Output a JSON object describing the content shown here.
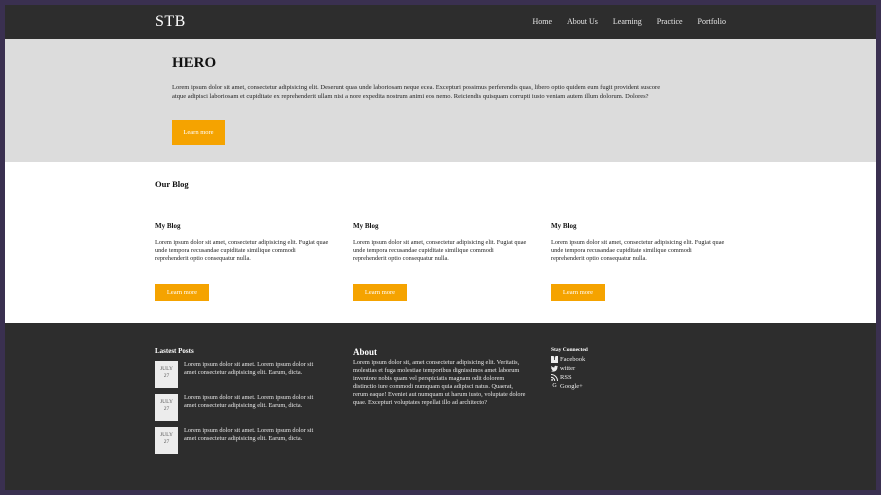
{
  "nav": {
    "brand": "STB",
    "links": [
      "Home",
      "About Us",
      "Learning",
      "Practice",
      "Portfolio"
    ]
  },
  "hero": {
    "title": "HERO",
    "text": "Lorem ipsum dolor sit amet, consectetur adipisicing elit. Deserunt quas unde laboriosam neque ecea. Excepturi possimus perferendis quas, libero optio quidem eum fugit provident suscore atque adipisci laboriosam et cupiditate ex reprehenderit ullam nisi a nore expedita nostrum animi eos nemo. Reiciendis quisquam corrupti iusto veniam autem illum dolorum. Dolores?",
    "button": "Learn more"
  },
  "blog": {
    "heading": "Our Blog",
    "cards": [
      {
        "title": "My Blog",
        "text": "Lorem ipsum dolor sit amet, consectetur adipisicing elit. Fugiat quae unde tempora recusandae cupiditate similique commodi reprehenderit optio consequatur nulla.",
        "button": "Learn more"
      },
      {
        "title": "My Blog",
        "text": "Lorem ipsum dolor sit amet, consectetur adipisicing elit. Fugiat quae unde tempora recusandae cupiditate similique commodi reprehenderit optio consequatur nulla.",
        "button": "Learn more"
      },
      {
        "title": "My Blog",
        "text": "Lorem ipsum dolor sit amet, consectetur adipisicing elit. Fugiat quae unde tempora recusandae cupiditate similique commodi reprehenderit optio consequatur nulla.",
        "button": "Learn more"
      }
    ]
  },
  "footer": {
    "latest": {
      "heading": "Lastest Posts",
      "posts": [
        {
          "month": "JULY",
          "day": "27",
          "text": "Lorem ipsum dolor sit amet. Lorem ipsum dolor sit amet consectetur adipisicing elit. Earum, dicta."
        },
        {
          "month": "JULY",
          "day": "27",
          "text": "Lorem ipsum dolor sit amet. Lorem ipsum dolor sit amet consectetur adipisicing elit. Earum, dicta."
        },
        {
          "month": "JULY",
          "day": "27",
          "text": "Lorem ipsum dolor sit amet. Lorem ipsum dolor sit amet consectetur adipisicing elit. Earum, dicta."
        }
      ]
    },
    "about": {
      "heading": "About",
      "text": "Lorem ipsum dolor sit, amet consectetur adipisicing elit. Veritatis, molestias et fuga molestiae temporibus dignissimos amet laborum inventore nobis quam vel perspiciatis magnam odit dolorem distinctio iure commodi numquam quia adipisci natus. Quaerat, rerum eaque! Eveniet aut numquam ut harum iusto, voluptate dolore quae. Excepturi voluptates repellat illo ad architecto?"
    },
    "social": {
      "heading": "Stay Connected",
      "items": [
        {
          "icon": "facebook-icon",
          "label": "Facebook"
        },
        {
          "icon": "twitter-icon",
          "label": "witter"
        },
        {
          "icon": "rss-icon",
          "label": "RSS"
        },
        {
          "icon": "google-plus-icon",
          "label": "Google+"
        }
      ]
    }
  },
  "colors": {
    "accent": "#f5a300",
    "dark": "#2d2d2d",
    "hero_bg": "#dcdcdc"
  }
}
